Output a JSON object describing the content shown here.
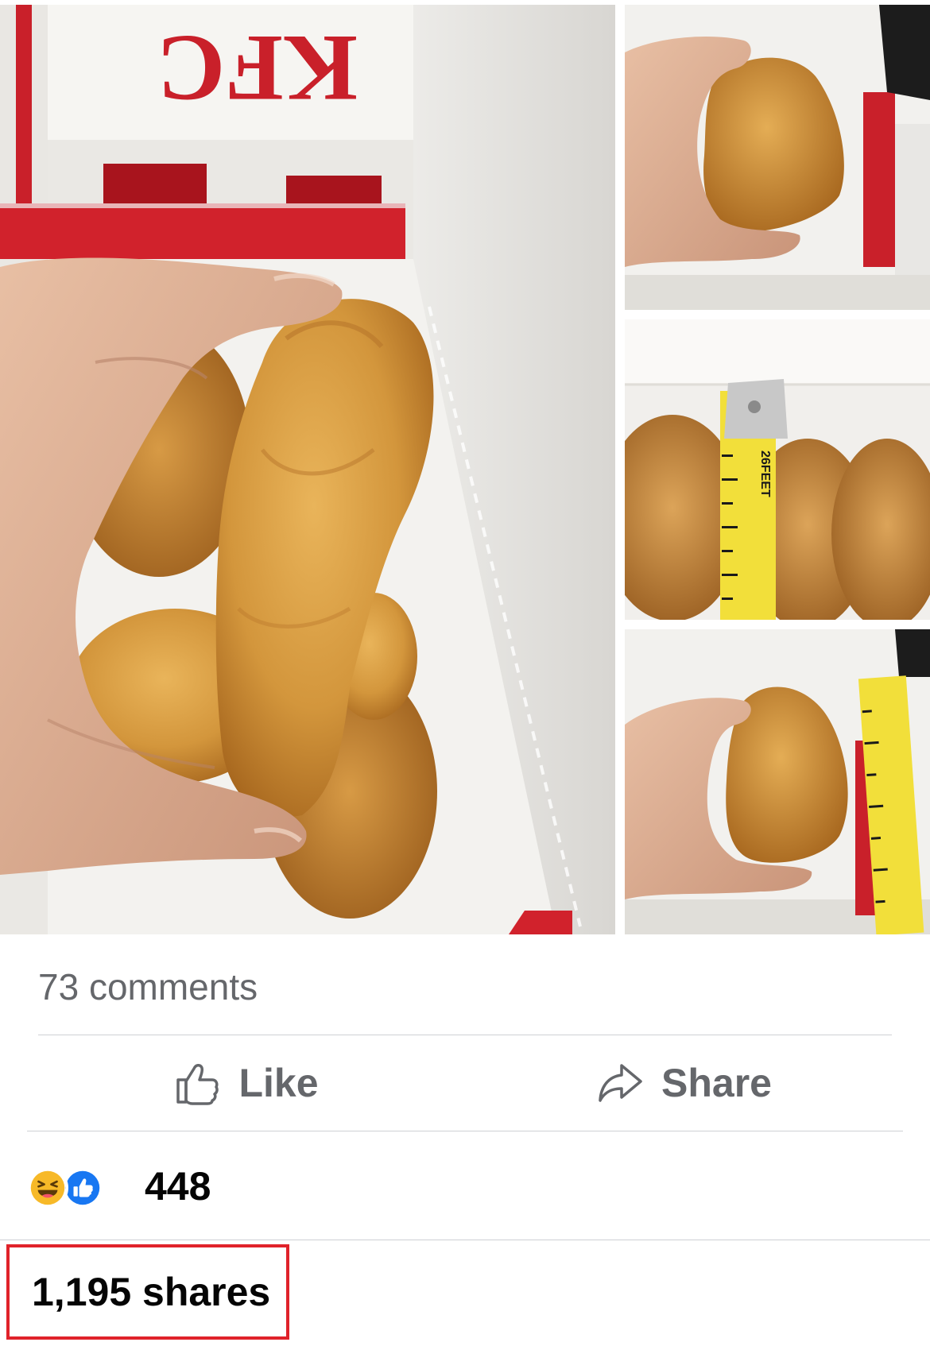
{
  "post": {
    "photos": [
      {
        "name": "main-photo",
        "label": "KFC"
      },
      {
        "name": "side-photo-1"
      },
      {
        "name": "side-photo-2",
        "tape_text": "26FEET"
      },
      {
        "name": "side-photo-3"
      }
    ],
    "comments_count": "73 comments",
    "actions": {
      "like_label": "Like",
      "like_icon": "thumbs-up-icon",
      "share_label": "Share",
      "share_icon": "share-arrow-icon"
    },
    "reactions": {
      "icons": [
        "haha-icon",
        "like-icon"
      ],
      "count": "448"
    },
    "shares_count": "1,195 shares"
  },
  "colors": {
    "highlight_border": "#e0222a",
    "secondary_text": "#65676b",
    "primary_text": "#050505",
    "divider": "#ced0d4",
    "like_blue": "#1877f2",
    "haha_yellow": "#f7b928"
  }
}
